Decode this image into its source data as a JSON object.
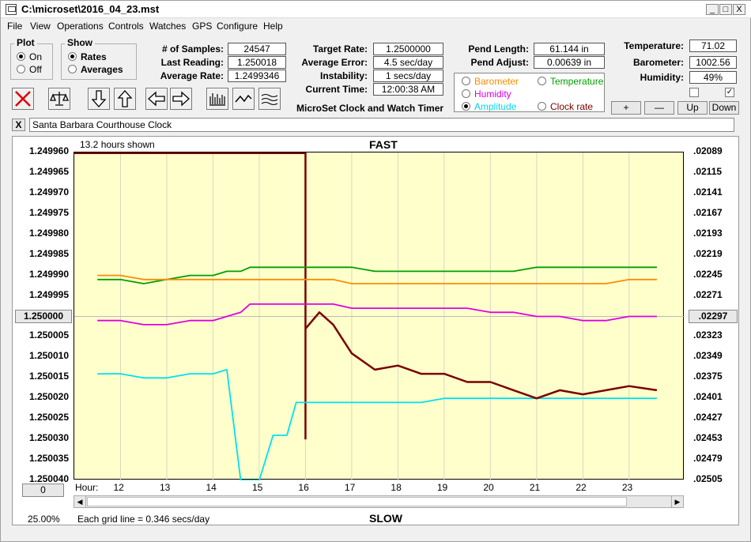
{
  "title": "C:\\microset\\2016_04_23.mst",
  "window_buttons": {
    "minimize": "_",
    "maximize": "□",
    "close": "X"
  },
  "menu": [
    "File",
    "View",
    "Operations",
    "Controls",
    "Watches",
    "GPS",
    "Configure",
    "Help"
  ],
  "plot_group": {
    "title": "Plot",
    "on": "On",
    "off": "Off",
    "selected": "On"
  },
  "show_group": {
    "title": "Show",
    "rates": "Rates",
    "averages": "Averages",
    "selected": "Rates"
  },
  "stats": {
    "samples_label": "# of Samples:",
    "samples": "24547",
    "last_label": "Last Reading:",
    "last": "1.250018",
    "avg_label": "Average Rate:",
    "avg": "1.2499346"
  },
  "rates": {
    "target_label": "Target Rate:",
    "target": "1.2500000",
    "error_label": "Average Error:",
    "error": "4.5 sec/day",
    "instability_label": "Instability:",
    "instability": "1 secs/day",
    "time_label": "Current Time:",
    "time": "12:00:38 AM"
  },
  "app_name": "MicroSet Clock and Watch Timer",
  "pend": {
    "length_label": "Pend Length:",
    "length": "61.144 in",
    "adjust_label": "Pend Adjust:",
    "adjust": "0.00639 in"
  },
  "sensor_radios": {
    "barometer": "Barometer",
    "temperature": "Temperature",
    "humidity": "Humidity",
    "amplitude": "Amplitude",
    "clock_rate": "Clock rate",
    "selected": "Amplitude",
    "colors": {
      "barometer": "#ff8c00",
      "temperature": "#00a000",
      "humidity": "#e000e0",
      "amplitude": "#00d8e8",
      "clock_rate": "#7a0000"
    }
  },
  "env": {
    "temp_label": "Temperature:",
    "temp": "71.02",
    "baro_label": "Barometer:",
    "baro": "1002.56",
    "hum_label": "Humidity:",
    "hum": "49%"
  },
  "checkboxes": [
    false,
    true
  ],
  "adjust_buttons": {
    "plus": "+",
    "minus": "—",
    "up": "Up",
    "down": "Down"
  },
  "clock_name": "Santa Barbara Courthouse Clock",
  "close_x": "X",
  "hours_shown": "13.2 hours shown",
  "fast_label": "FAST",
  "slow_label": "SLOW",
  "hour_label": "Hour:",
  "zero_button": "0",
  "zoom": "25.00%",
  "grid_note": "Each grid line = 0.346 secs/day",
  "colors": {
    "plot_bg": "#ffffcc",
    "rate": "#7a0000",
    "amplitude": "#00e0f0",
    "humidity": "#e000e0",
    "temperature": "#00a000",
    "barometer": "#ff8c00",
    "clock_rate_vline": "#7a0000"
  },
  "chart_data": {
    "type": "line",
    "left_axis": [
      "1.249960",
      "1.249965",
      "1.249970",
      "1.249975",
      "1.249980",
      "1.249985",
      "1.249990",
      "1.249995",
      "1.250000",
      "1.250005",
      "1.250010",
      "1.250015",
      "1.250020",
      "1.250025",
      "1.250030",
      "1.250035",
      "1.250040"
    ],
    "right_axis": [
      ".02089",
      ".02115",
      ".02141",
      ".02167",
      ".02193",
      ".02219",
      ".02245",
      ".02271",
      ".02297",
      ".02323",
      ".02349",
      ".02375",
      ".02401",
      ".02427",
      ".02453",
      ".02479",
      ".02505"
    ],
    "x_ticks": [
      "12",
      "13",
      "14",
      "15",
      "16",
      "17",
      "18",
      "19",
      "20",
      "21",
      "22",
      "23"
    ],
    "ylim": [
      1.24996,
      1.25004
    ],
    "x": [
      11.5,
      12.0,
      12.5,
      13.0,
      13.5,
      14.0,
      14.3,
      14.6,
      14.8,
      15.0,
      15.3,
      15.6,
      15.8,
      16.0,
      16.3,
      16.6,
      17.0,
      17.5,
      18.0,
      18.5,
      19.0,
      19.5,
      20.0,
      20.5,
      21.0,
      21.5,
      22.0,
      22.5,
      23.0,
      23.6
    ],
    "series": [
      {
        "name": "Temperature",
        "values": [
          1.249991,
          1.249991,
          1.249992,
          1.249991,
          1.24999,
          1.24999,
          1.249989,
          1.249989,
          1.249988,
          1.249988,
          1.249988,
          1.249988,
          1.249988,
          1.249988,
          1.249988,
          1.249988,
          1.249988,
          1.249989,
          1.249989,
          1.249989,
          1.249989,
          1.249989,
          1.249989,
          1.249989,
          1.249988,
          1.249988,
          1.249988,
          1.249988,
          1.249988,
          1.249988
        ]
      },
      {
        "name": "Barometer",
        "values": [
          1.24999,
          1.24999,
          1.249991,
          1.249991,
          1.249991,
          1.249991,
          1.249991,
          1.249991,
          1.249991,
          1.249991,
          1.249991,
          1.249991,
          1.249991,
          1.249991,
          1.249991,
          1.249991,
          1.249992,
          1.249992,
          1.249992,
          1.249992,
          1.249992,
          1.249992,
          1.249992,
          1.249992,
          1.249992,
          1.249992,
          1.249992,
          1.249992,
          1.249991,
          1.249991
        ]
      },
      {
        "name": "Humidity",
        "values": [
          1.250001,
          1.250001,
          1.250002,
          1.250002,
          1.250001,
          1.250001,
          1.25,
          1.249999,
          1.249997,
          1.249997,
          1.249997,
          1.249997,
          1.249997,
          1.249997,
          1.249997,
          1.249997,
          1.249998,
          1.249998,
          1.249998,
          1.249998,
          1.249998,
          1.249998,
          1.249999,
          1.249999,
          1.25,
          1.25,
          1.250001,
          1.250001,
          1.25,
          1.25
        ]
      },
      {
        "name": "Amplitude",
        "values": [
          1.250014,
          1.250014,
          1.250015,
          1.250015,
          1.250014,
          1.250014,
          1.250013,
          1.25004,
          1.25004,
          1.25004,
          1.250029,
          1.250029,
          1.250021,
          1.250021,
          1.250021,
          1.250021,
          1.250021,
          1.250021,
          1.250021,
          1.250021,
          1.25002,
          1.25002,
          1.25002,
          1.25002,
          1.25002,
          1.25002,
          1.25002,
          1.25002,
          1.25002,
          1.25002
        ]
      },
      {
        "name": "Clock rate",
        "values": [
          null,
          null,
          null,
          null,
          null,
          null,
          null,
          null,
          null,
          null,
          null,
          null,
          null,
          1.250003,
          1.249999,
          1.250002,
          1.250009,
          1.250013,
          1.250012,
          1.250014,
          1.250014,
          1.250016,
          1.250016,
          1.250018,
          1.25002,
          1.250018,
          1.250019,
          1.250018,
          1.250017,
          1.250018
        ]
      }
    ]
  }
}
